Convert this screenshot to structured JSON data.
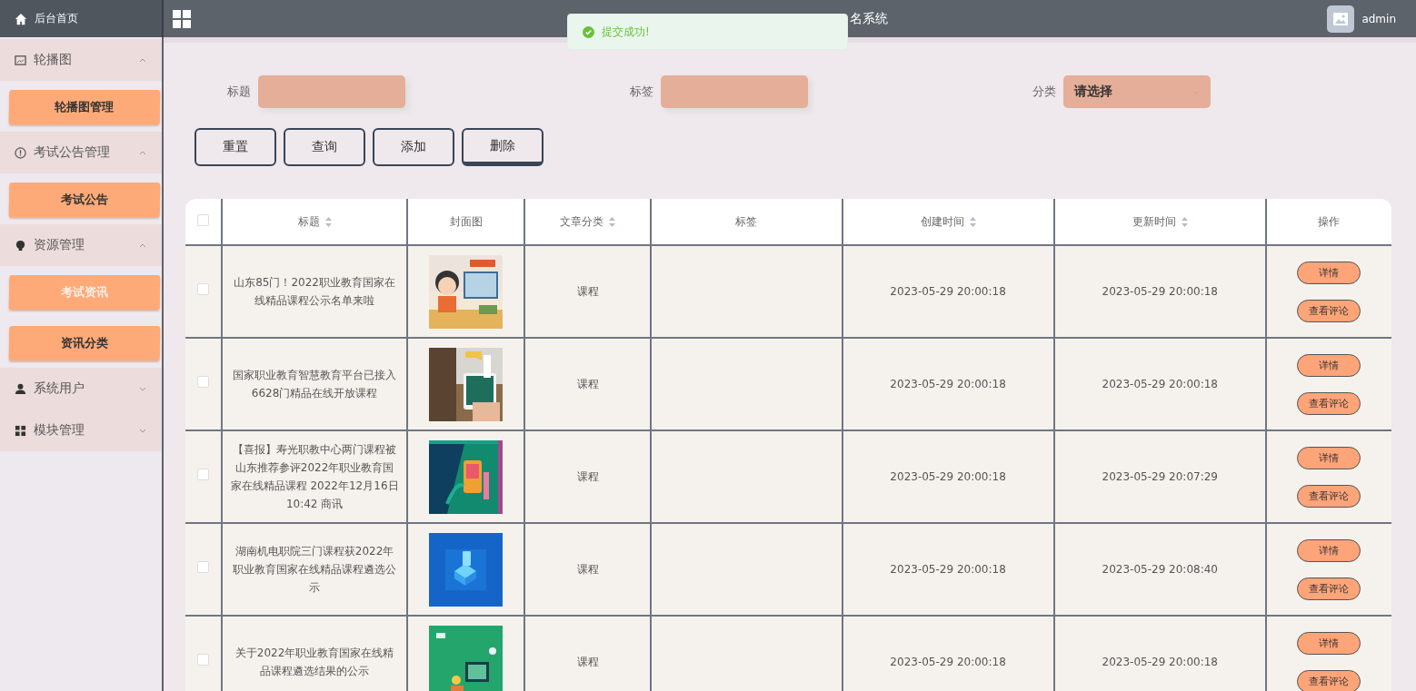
{
  "header": {
    "home": "后台首页",
    "title": "名系统",
    "user": "admin"
  },
  "toast": {
    "kind": "success",
    "text": "提交成功!"
  },
  "sidebar": {
    "groups": [
      {
        "label": "轮播图",
        "expanded": true,
        "children": [
          {
            "label": "轮播图管理",
            "selected": false
          }
        ]
      },
      {
        "label": "考试公告管理",
        "expanded": true,
        "children": [
          {
            "label": "考试公告",
            "selected": false
          }
        ]
      },
      {
        "label": "资源管理",
        "expanded": true,
        "children": [
          {
            "label": "考试资讯",
            "selected": true
          },
          {
            "label": "资讯分类",
            "selected": false
          }
        ]
      },
      {
        "label": "系统用户",
        "expanded": false
      },
      {
        "label": "模块管理",
        "expanded": false
      }
    ]
  },
  "search": {
    "fields": [
      {
        "label": "标题",
        "kind": "input"
      },
      {
        "label": "标签",
        "kind": "input"
      },
      {
        "label": "分类",
        "kind": "select",
        "value": "请选择"
      }
    ],
    "buttons": [
      "重置",
      "查询",
      "添加",
      "删除"
    ]
  },
  "table": {
    "select_all": {
      "checked": false
    },
    "columns": [
      {
        "label": "标题",
        "sortable": true
      },
      {
        "label": "封面图",
        "sortable": false
      },
      {
        "label": "文章分类",
        "sortable": true
      },
      {
        "label": "标签",
        "sortable": false
      },
      {
        "label": "创建时间",
        "sortable": true
      },
      {
        "label": "更新时间",
        "sortable": true
      },
      {
        "label": "操作",
        "sortable": false
      }
    ],
    "rows": [
      {
        "checked": false,
        "title": "山东85门！2022职业教育国家在线精品课程公示名单来啦",
        "category": "课程",
        "created": "2023-05-29 20:00:18",
        "updated": "2023-05-29 20:00:18",
        "actions": [
          "详情",
          "查看评论"
        ]
      },
      {
        "checked": false,
        "title": "国家职业教育智慧教育平台已接入6628门精品在线开放课程",
        "category": "课程",
        "created": "2023-05-29 20:00:18",
        "updated": "2023-05-29 20:00:18",
        "actions": [
          "详情",
          "查看评论"
        ]
      },
      {
        "checked": false,
        "title": "【喜报】寿光职教中心两门课程被山东推荐参评2022年职业教育国家在线精品课程 2022年12月16日 10:42 商讯",
        "category": "课程",
        "created": "2023-05-29 20:00:18",
        "updated": "2023-05-29 20:07:29",
        "actions": [
          "详情",
          "查看评论"
        ]
      },
      {
        "checked": false,
        "title": "湖南机电职院三门课程获2022年职业教育国家在线精品课程遴选公示",
        "category": "课程",
        "created": "2023-05-29 20:00:18",
        "updated": "2023-05-29 20:08:40",
        "actions": [
          "详情",
          "查看评论"
        ]
      },
      {
        "checked": false,
        "title": "关于2022年职业教育国家在线精品课程遴选结果的公示",
        "category": "课程",
        "created": "2023-05-29 20:00:18",
        "updated": "2023-05-29 20:00:18",
        "actions": [
          "详情",
          "查看评论"
        ]
      }
    ]
  }
}
